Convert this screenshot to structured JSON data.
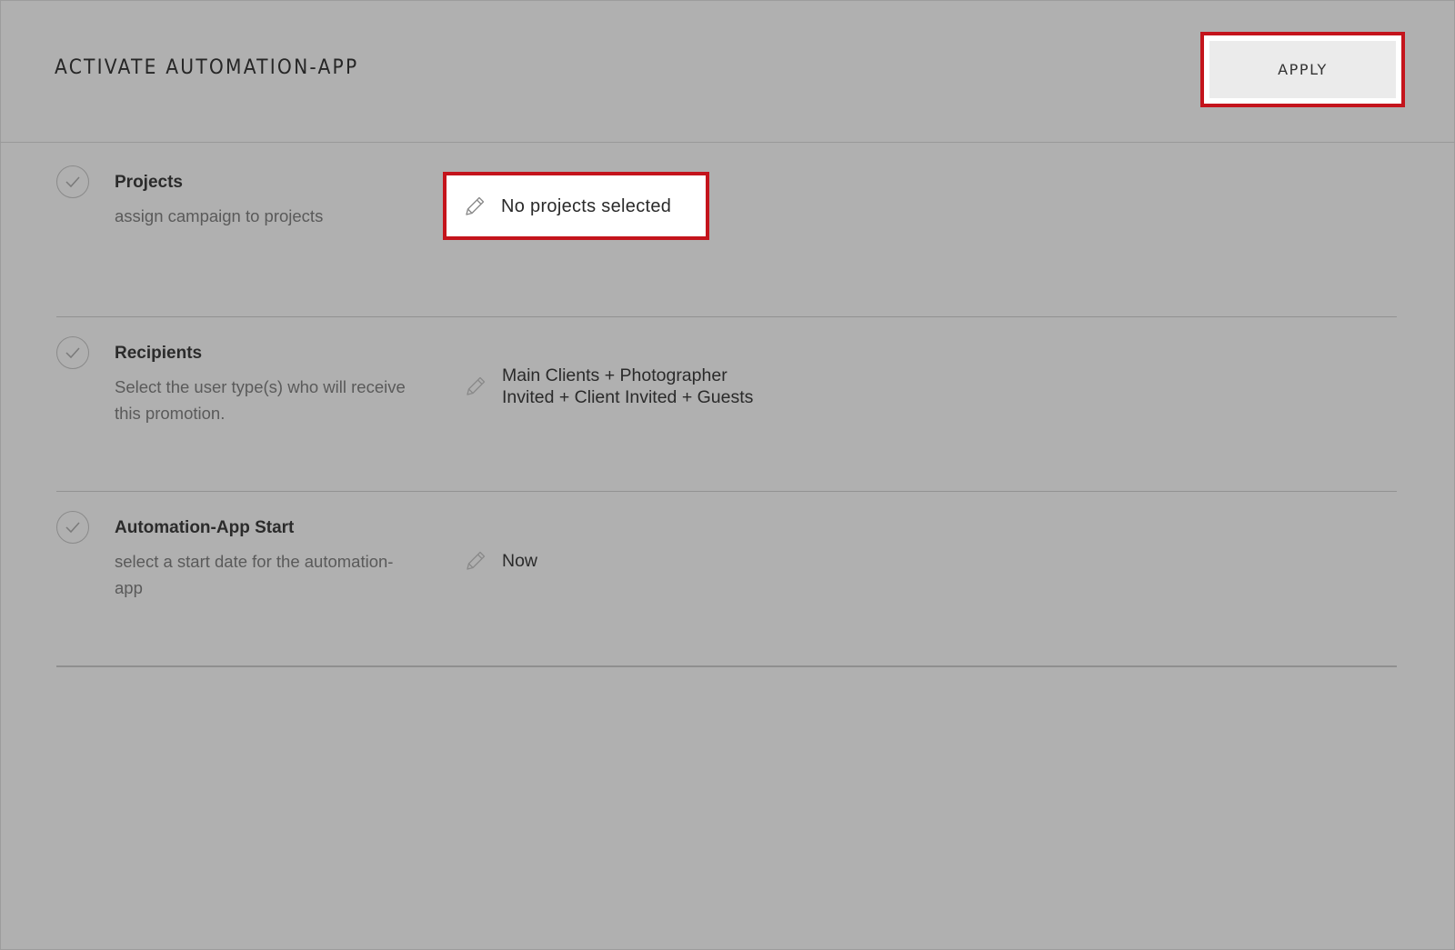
{
  "header": {
    "title": "ACTIVATE AUTOMATION-APP",
    "apply_label": "APPLY"
  },
  "sections": [
    {
      "title": "Projects",
      "description": "assign campaign to projects",
      "value": "No projects selected",
      "highlighted": true,
      "icon": "check-icon",
      "edit_icon": "pencil-icon"
    },
    {
      "title": "Recipients",
      "description": "Select the user type(s) who will receive this promotion.",
      "value_line1": "Main Clients + Photographer",
      "value_line2": "Invited + Client Invited + Guests",
      "icon": "check-icon",
      "edit_icon": "pencil-icon"
    },
    {
      "title": "Automation-App Start",
      "description": "select a start date for the automation-app",
      "value": "Now",
      "icon": "check-icon",
      "edit_icon": "pencil-icon"
    }
  ],
  "colors": {
    "background": "#b0b0b0",
    "highlight": "#c4141c",
    "button": "#ebebeb"
  }
}
